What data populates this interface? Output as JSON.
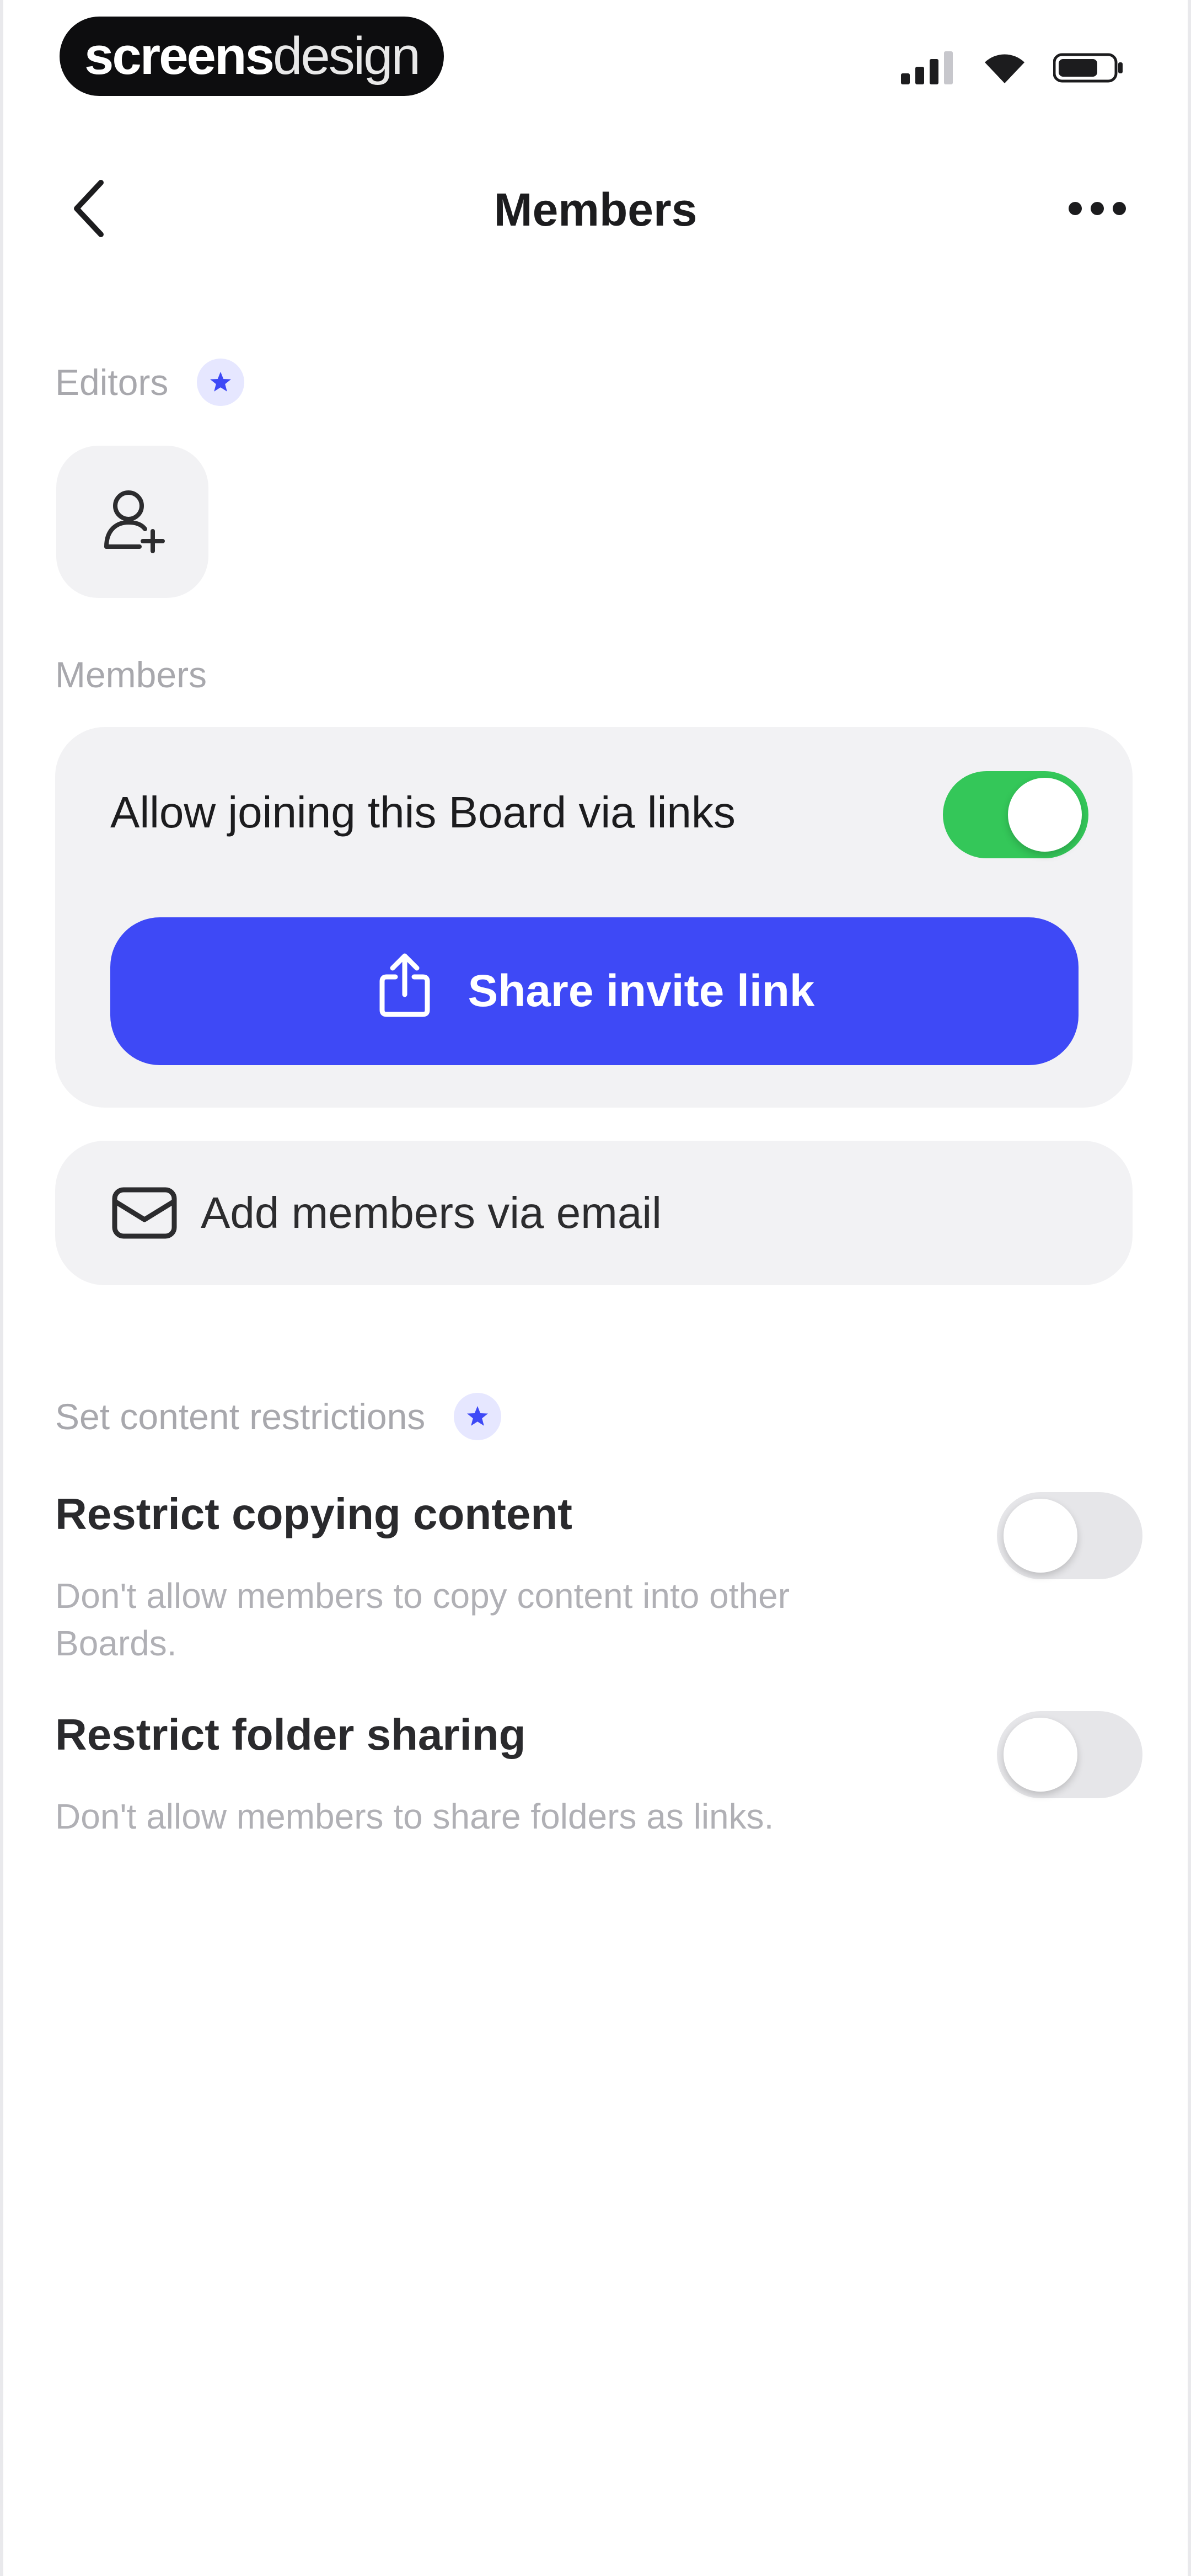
{
  "status_bar": {
    "brand_bold": "screens",
    "brand_light": "design",
    "icons": [
      "signal-icon",
      "wifi-icon",
      "battery-icon"
    ]
  },
  "nav": {
    "title": "Members",
    "back_icon": "chevron-left-icon",
    "more_icon": "more-horizontal-icon"
  },
  "editors": {
    "label": "Editors",
    "badge_icon": "star-badge-icon",
    "add_icon": "add-person-icon"
  },
  "members": {
    "label": "Members",
    "allow_links_label": "Allow joining this Board via links",
    "allow_links_enabled": true,
    "share_button_label": "Share invite link",
    "add_via_email_label": "Add members via email"
  },
  "restrictions": {
    "label": "Set content restrictions",
    "items": [
      {
        "title": "Restrict copying content",
        "description": "Don't allow members to copy content into other Boards.",
        "enabled": false
      },
      {
        "title": "Restrict folder sharing",
        "description": "Don't allow members to share folders as links.",
        "enabled": false
      }
    ]
  },
  "colors": {
    "accent": "#3e49f6",
    "toggle_on": "#34c759",
    "card_bg": "#f2f2f4",
    "muted_text": "#a8a8ad"
  }
}
